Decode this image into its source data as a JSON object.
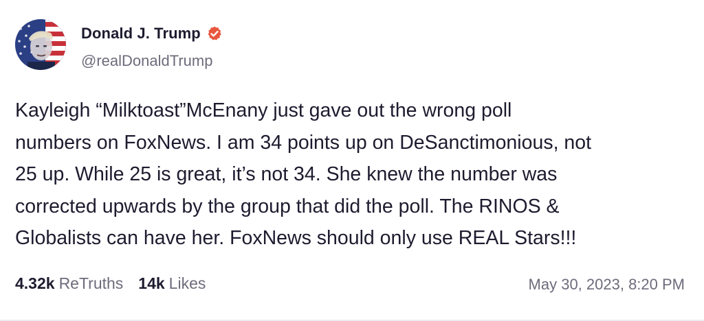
{
  "author": {
    "display_name": "Donald J. Trump",
    "handle": "@realDonaldTrump",
    "verified": true,
    "avatar_icon": "avatar-portrait-flag",
    "verified_icon": "verified-badge-icon",
    "verified_color": "#e8573f"
  },
  "post": {
    "text": "Kayleigh “Milktoast”McEnany just gave out the wrong poll\nnumbers on FoxNews. I am 34 points up on DeSanctimonious, not\n25 up. While 25 is great, it’s not 34. She knew the number was\ncorrected upwards by the group that did the poll. The RINOS &\nGlobalists can have her. FoxNews should only use REAL Stars!!!"
  },
  "stats": {
    "retruths_count": "4.32k",
    "retruths_label": "ReTruths",
    "likes_count": "14k",
    "likes_label": "Likes"
  },
  "timestamp": "May 30, 2023, 8:20 PM",
  "colors": {
    "text_primary": "#1d1b2e",
    "text_secondary": "#6e6b7b",
    "badge": "#e8573f"
  }
}
